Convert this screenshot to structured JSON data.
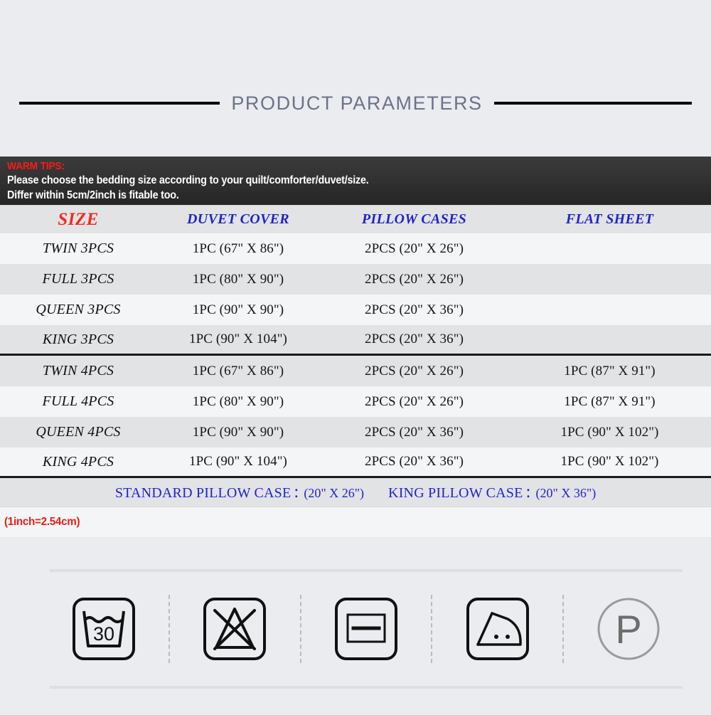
{
  "header": {
    "title": "PRODUCT PARAMETERS"
  },
  "warm_tips": {
    "heading": "WARM TIPS:",
    "line1": "Please choose the bedding size according to your quilt/comforter/duvet/size.",
    "line2": "Differ within 5cm/2inch is fitable too."
  },
  "size_table": {
    "columns": [
      "SIZE",
      "DUVET COVER",
      "PILLOW CASES",
      "FLAT SHEET"
    ],
    "rows_3pcs": [
      {
        "size": "TWIN  3PCS",
        "duvet": "1PC (67\" X 86\")",
        "pillow": "2PCS (20\" X 26\")",
        "flat": ""
      },
      {
        "size": "FULL  3PCS",
        "duvet": "1PC  (80\" X 90\")",
        "pillow": "2PCS (20\" X 26\")",
        "flat": ""
      },
      {
        "size": "QUEEN 3PCS",
        "duvet": "1PC (90\" X 90\")",
        "pillow": "2PCS (20\" X 36\")",
        "flat": ""
      },
      {
        "size": "KING  3PCS",
        "duvet": "1PC (90\" X 104\")",
        "pillow": "2PCS (20\" X 36\")",
        "flat": ""
      }
    ],
    "rows_4pcs": [
      {
        "size": "TWIN  4PCS",
        "duvet": "1PC (67\" X 86\")",
        "pillow": "2PCS (20\" X 26\")",
        "flat": "1PC (87\" X 91\")"
      },
      {
        "size": "FULL  4PCS",
        "duvet": "1PC (80\" X 90\")",
        "pillow": "2PCS  (20\" X 26\")",
        "flat": "1PC (87\" X 91\")"
      },
      {
        "size": "QUEEN 4PCS",
        "duvet": "1PC (90\" X 90\")",
        "pillow": "2PCS  (20\" X 36\")",
        "flat": "1PC (90\" X 102\")"
      },
      {
        "size": "KING  4PCS",
        "duvet": "1PC (90\" X 104\")",
        "pillow": "2PCS  (20\" X 36\")",
        "flat": "1PC (90\" X 102\")"
      }
    ]
  },
  "pillow_footer": {
    "standard_label": "STANDARD PILLOW CASE",
    "standard_colon": ":",
    "standard_dim": "(20\" X 26\")",
    "king_label": "KING PILLOW CASE",
    "king_colon": ":",
    "king_dim": "(20\" X 36\")"
  },
  "conversion": {
    "note": "(1inch=2.54cm)"
  },
  "care_symbols": [
    {
      "name": "wash-30-icon",
      "label": "30"
    },
    {
      "name": "do-not-bleach-icon",
      "label": ""
    },
    {
      "name": "dry-flat-icon",
      "label": ""
    },
    {
      "name": "iron-two-dots-icon",
      "label": ""
    },
    {
      "name": "dry-clean-p-icon",
      "label": "P"
    }
  ],
  "colors": {
    "background": "#eaecf0",
    "title_text": "#6b7386",
    "banner_dark": "#343434",
    "accent_red": "#ef2b24",
    "accent_blue": "#1f24cf",
    "row_light": "#f4f5f6",
    "row_dark": "#e2e3e4"
  }
}
